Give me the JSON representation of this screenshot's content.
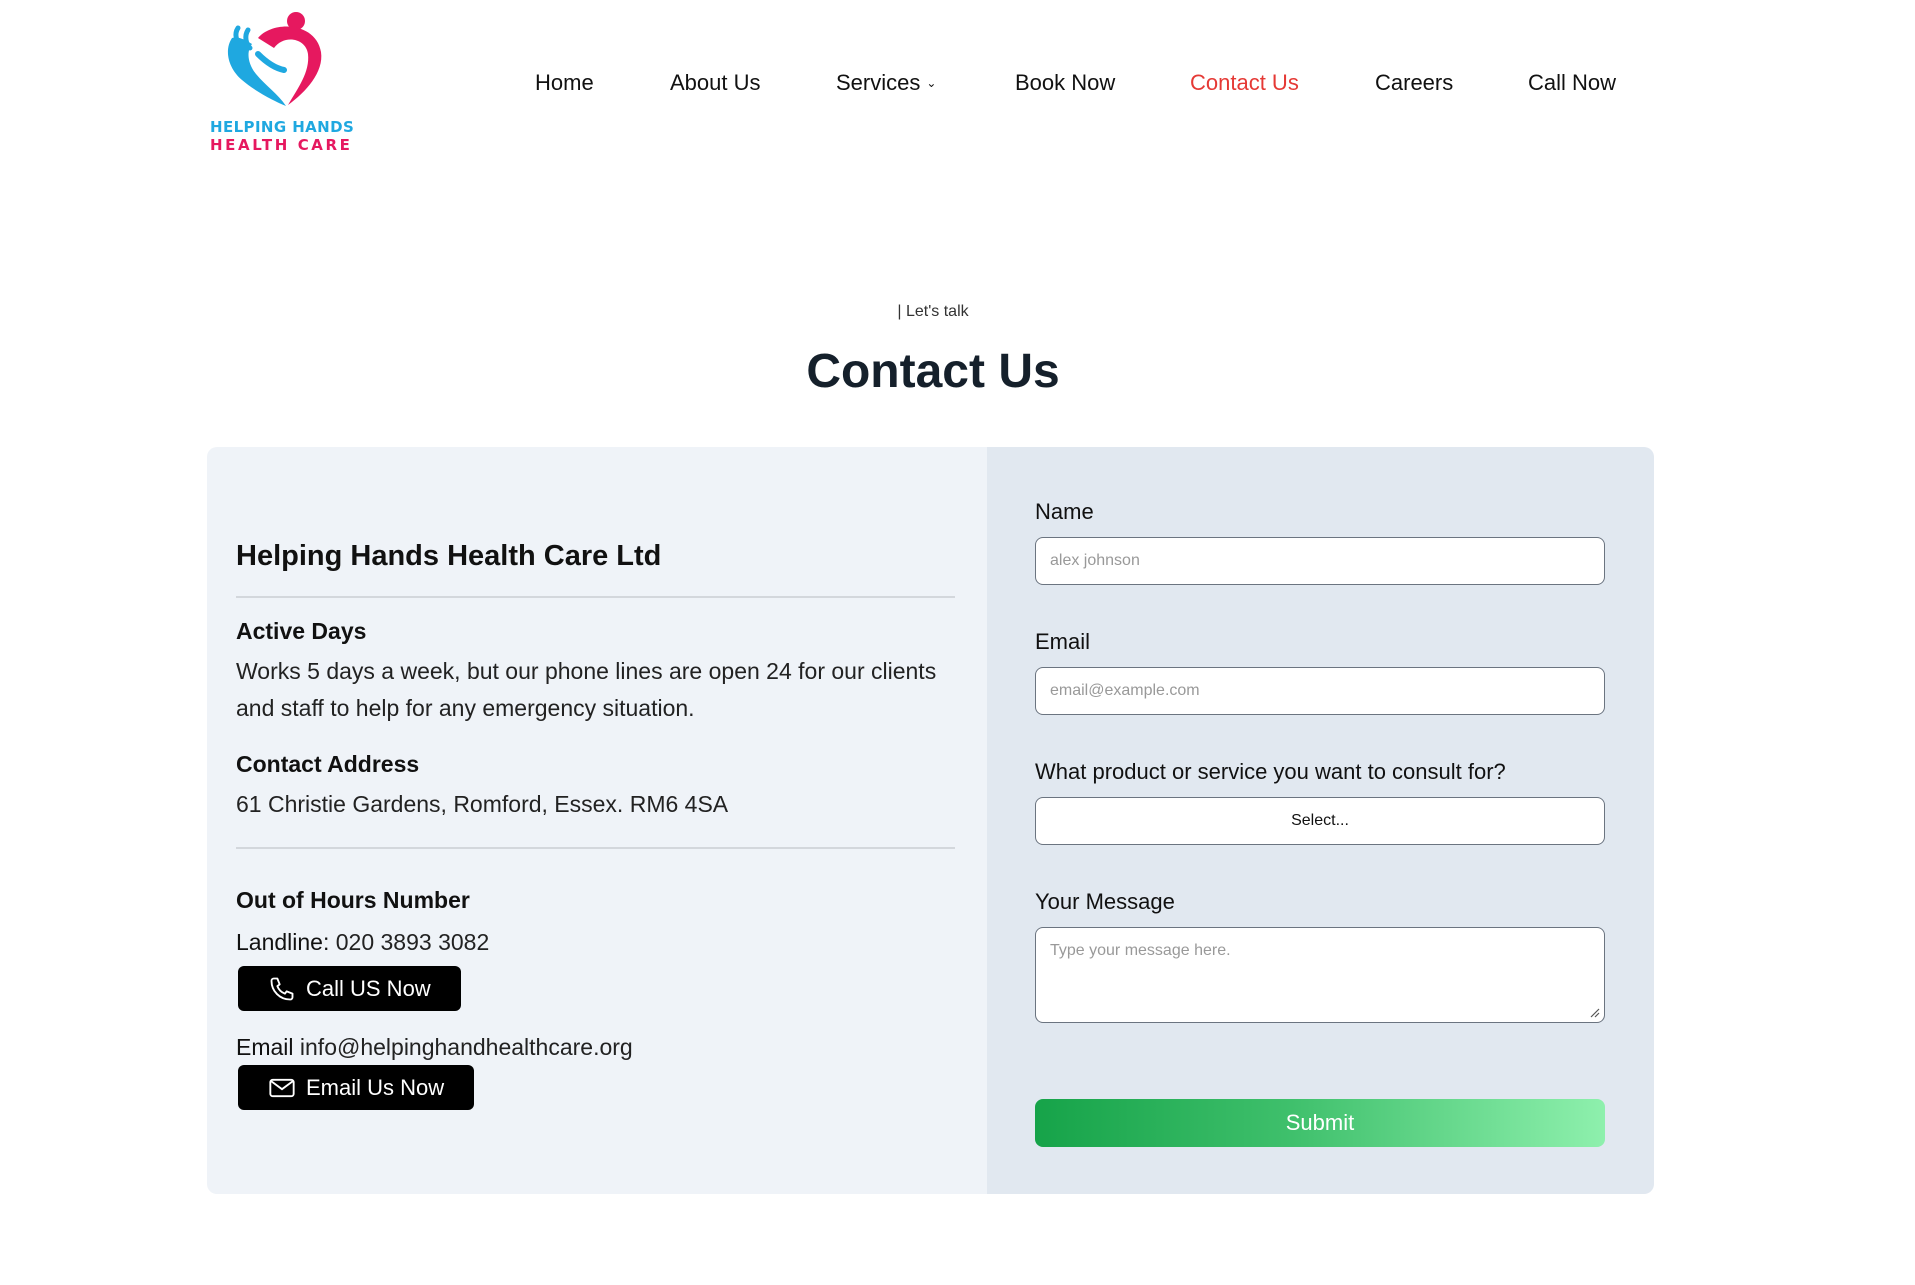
{
  "brand": {
    "logo_line1": "HELPING HANDS",
    "logo_line2": "HEALTH CARE",
    "logo_icon": "heart-hands-icon",
    "colors": {
      "blue": "#1fa8e0",
      "pink": "#e6185f"
    }
  },
  "nav": {
    "items": [
      {
        "label": "Home"
      },
      {
        "label": "About Us"
      },
      {
        "label": "Services",
        "chevron": "⌄"
      },
      {
        "label": "Book Now"
      },
      {
        "label": "Contact Us",
        "active": true
      },
      {
        "label": "Careers"
      },
      {
        "label": "Call Now"
      }
    ],
    "active_color": "#e53935"
  },
  "section": {
    "eyebrow": "| Let's talk",
    "title": "Contact Us"
  },
  "info": {
    "company": "Helping Hands Health Care Ltd",
    "active_days_label": "Active Days",
    "active_days_text": "Works 5 days a week, but our phone lines are open 24 for our clients and staff to help for any emergency situation.",
    "address_label": "Contact Address",
    "address_text": "61 Christie Gardens, Romford, Essex. RM6 4SA",
    "ooh_label": "Out of Hours Number",
    "landline_label": "Landline:",
    "landline_value": "020 3893 3082",
    "call_button": "Call US Now",
    "email_label": "Email",
    "email_value": "info@helpinghandhealthcare.org",
    "email_button": "Email Us Now"
  },
  "form": {
    "name_label": "Name",
    "name_placeholder": "alex johnson",
    "email_label": "Email",
    "email_placeholder": "email@example.com",
    "service_label": "What product or service you want to consult for?",
    "service_selected": "Select...",
    "message_label": "Your Message",
    "message_placeholder": "Type your message here.",
    "submit_label": "Submit"
  }
}
